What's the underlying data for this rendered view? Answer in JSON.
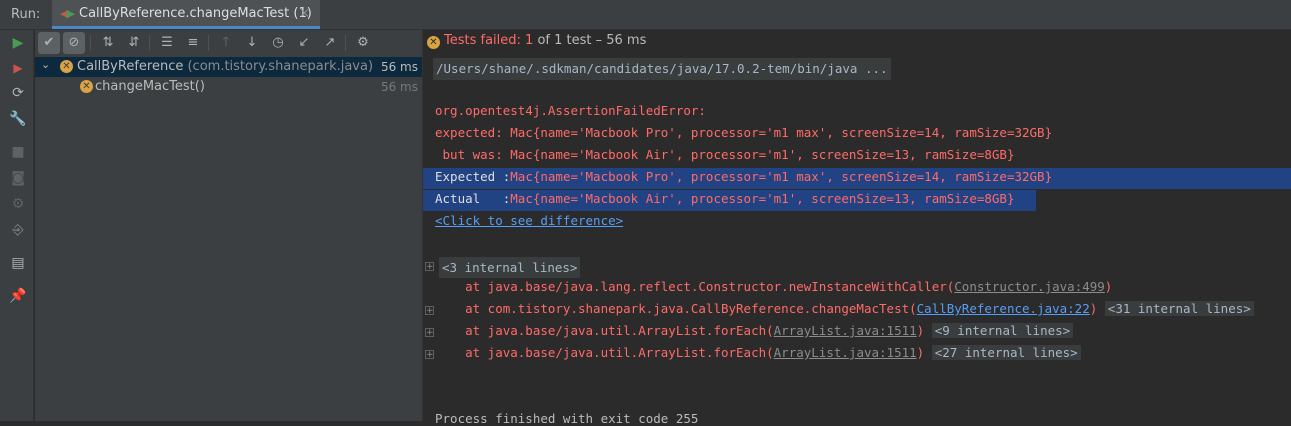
{
  "header": {
    "run_label": "Run:",
    "tab_title": "CallByReference.changeMacTest (1)",
    "tab_close": "×"
  },
  "status": {
    "failed_prefix": "Tests failed: ",
    "failed_count": "1",
    "rest": " of 1 test – 56 ms"
  },
  "tree": {
    "root": {
      "name": "CallByReference",
      "package": " (com.tistory.shanepark.java)",
      "time": "56 ms"
    },
    "child": {
      "name": "changeMacTest()",
      "time": "56 ms"
    }
  },
  "console": {
    "path_line": "/Users/shane/.sdkman/candidates/java/17.0.2-tem/bin/java ...",
    "error_class": "org.opentest4j.AssertionFailedError:",
    "expected_line": "expected: Mac{name='Macbook Pro', processor='m1 max', screenSize=14, ramSize=32GB}",
    "butwas_line": " but was: Mac{name='Macbook Air', processor='m1', screenSize=13, ramSize=8GB}",
    "expected_label": "Expected :",
    "expected_value": "Mac{name='Macbook Pro', processor='m1 max', screenSize=14, ramSize=32GB}",
    "actual_label": "Actual   :",
    "actual_value": "Mac{name='Macbook Air', processor='m1', screenSize=13, ramSize=8GB}",
    "diff_link": "<Click to see difference>",
    "fold1": "<3 internal lines>",
    "stack": [
      {
        "prefix": "    at java.base/java.lang.reflect.Constructor.newInstanceWithCaller(",
        "link": "Constructor.java:499",
        "suffix": ")",
        "fold": ""
      },
      {
        "prefix": "    at com.tistory.shanepark.java.CallByReference.changeMacTest(",
        "link": "CallByReference.java:22",
        "suffix": ")",
        "fold": "<31 internal lines>"
      },
      {
        "prefix": "    at java.base/java.util.ArrayList.forEach(",
        "link": "ArrayList.java:1511",
        "suffix": ")",
        "fold": "<9 internal lines>"
      },
      {
        "prefix": "    at java.base/java.util.ArrayList.forEach(",
        "link": "ArrayList.java:1511",
        "suffix": ")",
        "fold": "<27 internal lines>"
      }
    ],
    "exit_line": "Process finished with exit code 255"
  },
  "icons": {
    "left_toolbar": [
      "run-icon",
      "rerun-failed-icon",
      "debug-icon",
      "wrench-icon",
      "stop-icon",
      "camera-icon",
      "gear-disabled-icon",
      "exit-icon",
      "layout-icon",
      "pin-icon"
    ],
    "tree_toolbar": [
      "show-passed-icon",
      "show-ignored-icon",
      "sort-alpha-icon",
      "sort-duration-icon",
      "expand-all-icon",
      "collapse-all-icon",
      "prev-failed-icon",
      "next-failed-icon",
      "history-icon",
      "import-icon",
      "export-icon",
      "settings-icon"
    ]
  },
  "colors": {
    "error": "#ff6b68",
    "link": "#589df6",
    "selection": "#214283",
    "fail_icon": "#d9a343",
    "run_green": "#499c54"
  }
}
